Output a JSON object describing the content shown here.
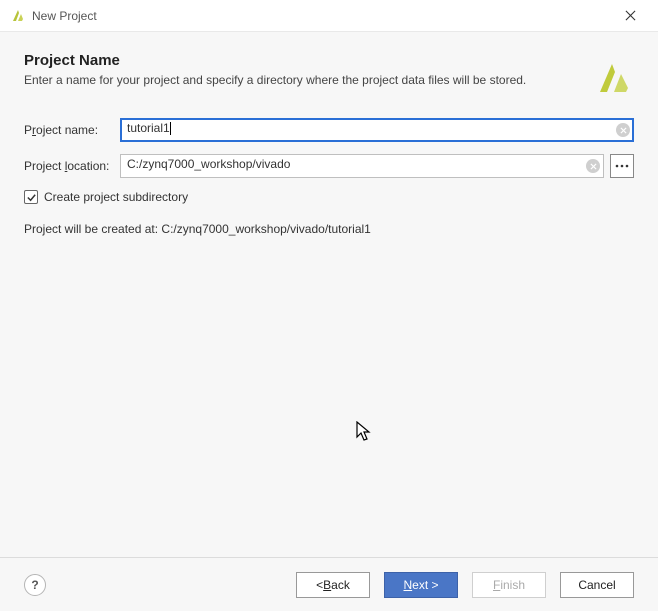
{
  "window": {
    "title": "New Project"
  },
  "header": {
    "title": "Project Name",
    "subtitle": "Enter a name for your project and specify a directory where the project data files will be stored."
  },
  "form": {
    "name_label_pre": "P",
    "name_label_u": "r",
    "name_label_post": "oject name:",
    "name_value": "tutorial1",
    "location_label_pre": "Project ",
    "location_label_u": "l",
    "location_label_post": "ocation:",
    "location_value": "C:/zynq7000_workshop/vivado",
    "subdir_label": "Create project subdirectory",
    "subdir_checked": true,
    "created_at_label": "Project will be created at: C:/zynq7000_workshop/vivado/tutorial1"
  },
  "footer": {
    "back_pre": "< ",
    "back_u": "B",
    "back_post": "ack",
    "next_u": "N",
    "next_post": "ext >",
    "finish_u": "F",
    "finish_post": "inish",
    "cancel": "Cancel"
  },
  "colors": {
    "primary": "#4a76c6"
  }
}
